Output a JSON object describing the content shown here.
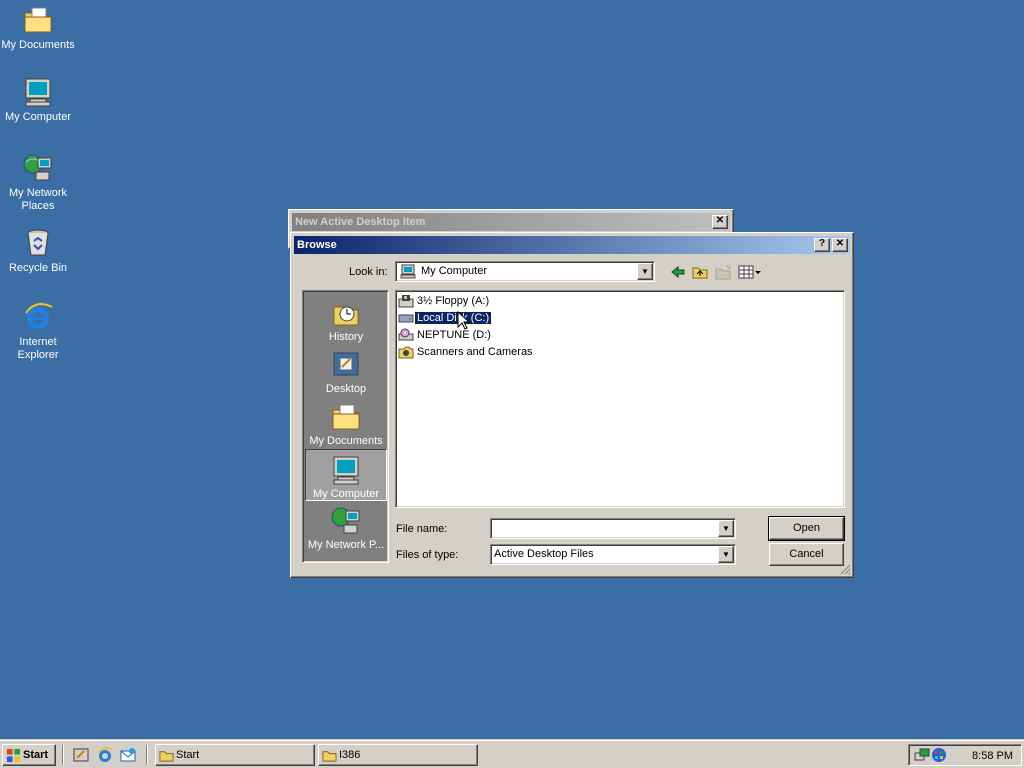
{
  "desktop": {
    "icons": [
      {
        "label": "My Documents",
        "icon": "my-documents-icon"
      },
      {
        "label": "My Computer",
        "icon": "my-computer-icon"
      },
      {
        "label": "My Network Places",
        "icon": "network-places-icon"
      },
      {
        "label": "Recycle Bin",
        "icon": "recycle-bin-icon"
      },
      {
        "label": "Internet Explorer",
        "icon": "internet-explorer-icon"
      }
    ]
  },
  "background_window": {
    "title": "New Active Desktop Item",
    "close_glyph": "✕"
  },
  "browse_dialog": {
    "title": "Browse",
    "help_glyph": "?",
    "close_glyph": "✕",
    "look_in_label": "Look in:",
    "look_in_value": "My Computer",
    "places": [
      {
        "label": "History",
        "icon": "history-icon",
        "selected": false
      },
      {
        "label": "Desktop",
        "icon": "desktop-icon",
        "selected": false
      },
      {
        "label": "My Documents",
        "icon": "my-documents-icon",
        "selected": false
      },
      {
        "label": "My Computer",
        "icon": "my-computer-icon",
        "selected": true
      },
      {
        "label": "My Network P...",
        "icon": "network-places-icon",
        "selected": false
      }
    ],
    "files": [
      {
        "name": "3½ Floppy (A:)",
        "icon": "floppy-drive-icon",
        "selected": false
      },
      {
        "name": "Local Disk (C:)",
        "icon": "hard-disk-icon",
        "selected": true
      },
      {
        "name": "NEPTUNE (D:)",
        "icon": "cd-drive-icon",
        "selected": false
      },
      {
        "name": "Scanners and Cameras",
        "icon": "camera-icon",
        "selected": false
      }
    ],
    "file_name_label": "File name:",
    "file_name_value": "",
    "files_of_type_label": "Files of type:",
    "files_of_type_value": "Active Desktop Files",
    "open_label": "Open",
    "cancel_label": "Cancel"
  },
  "taskbar": {
    "start_label": "Start",
    "tasks": [
      {
        "label": "Start",
        "icon": "folder-icon"
      },
      {
        "label": "I386",
        "icon": "folder-icon"
      }
    ],
    "clock": "8:58 PM"
  }
}
